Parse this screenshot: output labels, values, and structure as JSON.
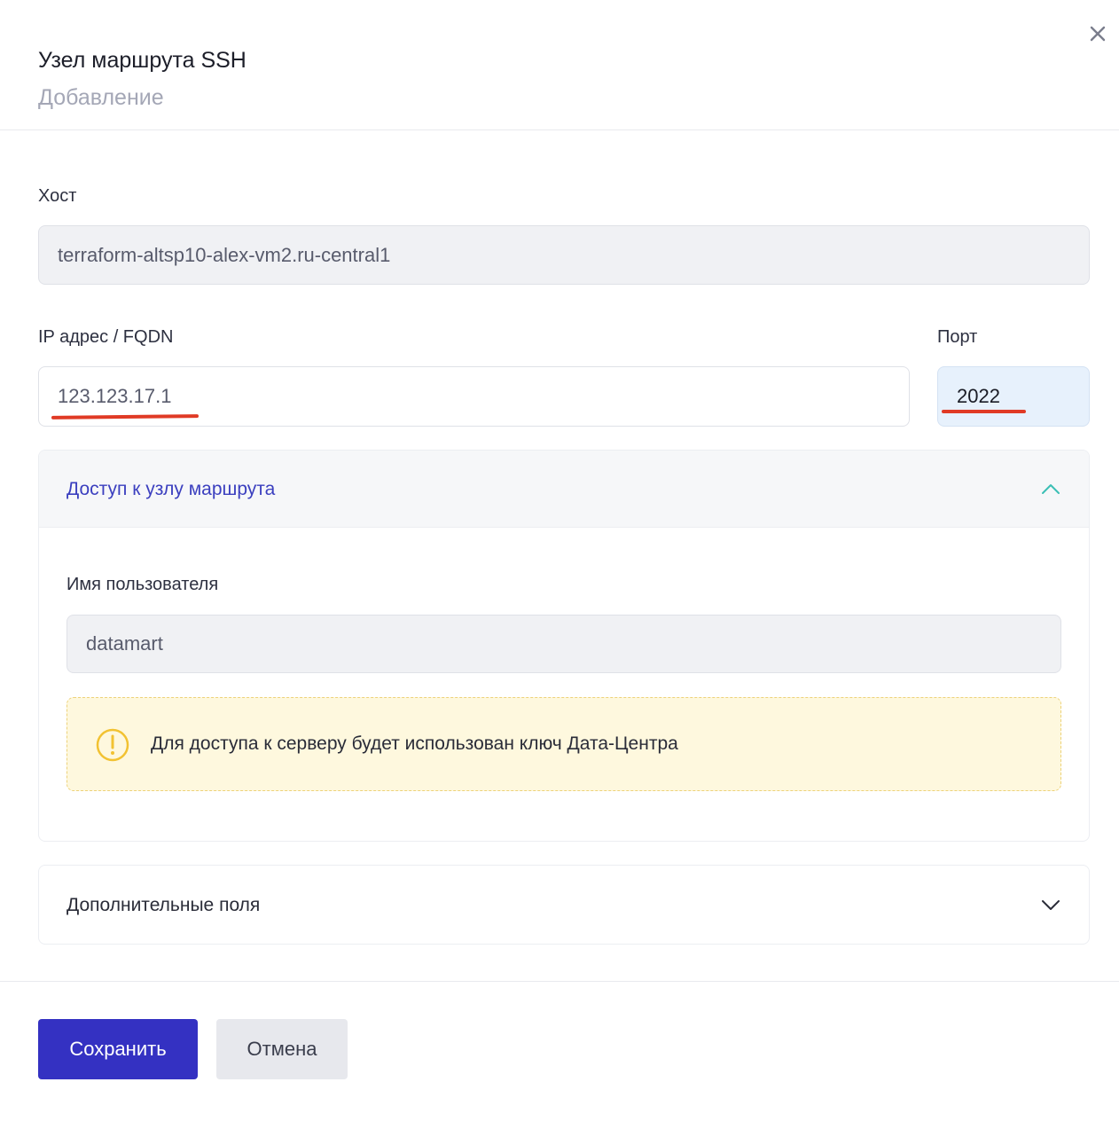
{
  "header": {
    "title": "Узел маршрута SSH",
    "subtitle": "Добавление",
    "close_icon": "close-icon"
  },
  "form": {
    "host": {
      "label": "Хост",
      "value": "terraform-altsp10-alex-vm2.ru-central1",
      "disabled": true
    },
    "ip": {
      "label": "IP адрес / FQDN",
      "value": "123.123.17.1"
    },
    "port": {
      "label": "Порт",
      "value": "2022"
    }
  },
  "access_section": {
    "title": "Доступ к узлу маршрута",
    "expanded": true,
    "chevron_icon": "chevron-up-icon",
    "username": {
      "label": "Имя пользователя",
      "value": "datamart",
      "disabled": true
    },
    "alert": {
      "icon": "warning-icon",
      "text": "Для доступа к серверу будет использован ключ Дата-Центра"
    }
  },
  "extra_section": {
    "title": "Дополнительные поля",
    "expanded": false,
    "chevron_icon": "chevron-down-icon"
  },
  "buttons": {
    "save": "Сохранить",
    "cancel": "Отмена"
  },
  "colors": {
    "primary": "#3431c2",
    "accent_link": "#3b3fbf",
    "chevron_teal": "#3bbfb5",
    "annotation_red": "#e03a25",
    "warning": "#f2c232"
  }
}
